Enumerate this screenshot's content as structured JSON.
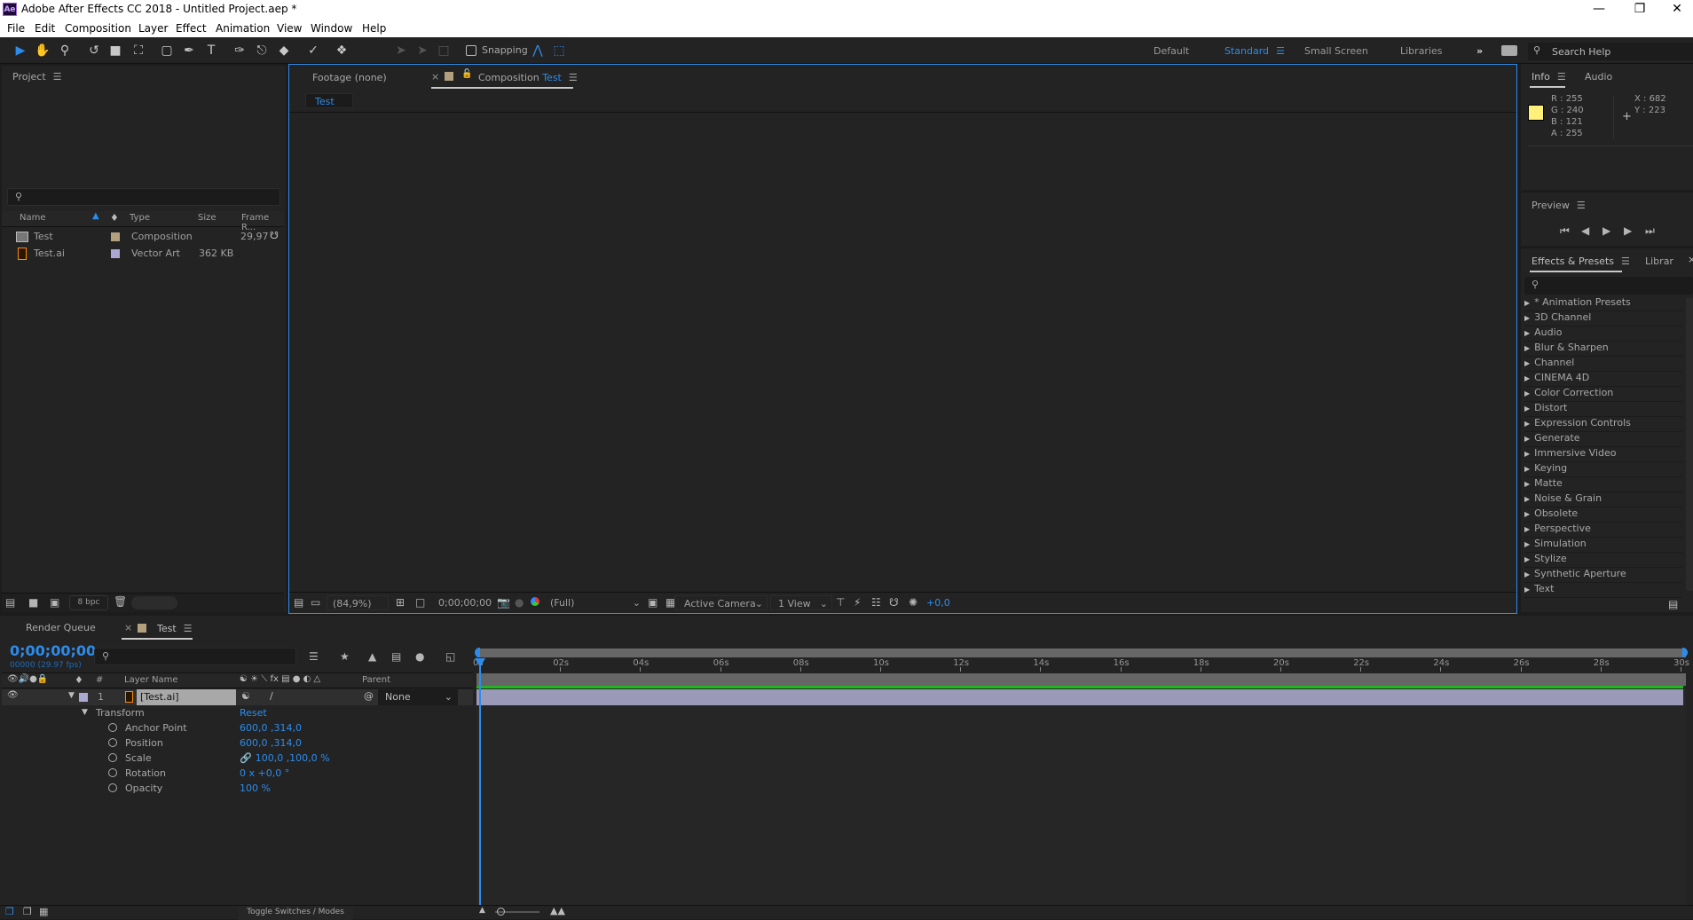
{
  "window": {
    "title": "Adobe After Effects CC 2018 - Untitled Project.aep *",
    "app_badge": "Ae"
  },
  "menu": [
    "File",
    "Edit",
    "Composition",
    "Layer",
    "Effect",
    "Animation",
    "View",
    "Window",
    "Help"
  ],
  "toolbar": {
    "snapping_label": "Snapping",
    "workspaces": [
      "Default",
      "Standard",
      "Small Screen",
      "Libraries"
    ],
    "active_workspace": "Standard",
    "search_help_placeholder": "Search Help"
  },
  "project": {
    "title": "Project",
    "columns": [
      "Name",
      "Type",
      "Size",
      "Frame R..."
    ],
    "items": [
      {
        "name": "Test",
        "type": "Composition",
        "size": "",
        "frame_rate": "29,97",
        "label_color": "#b3a07f"
      },
      {
        "name": "Test.ai",
        "type": "Vector Art",
        "size": "362 KB",
        "frame_rate": "",
        "label_color": "#a9a9d2"
      }
    ],
    "bpc": "8 bpc"
  },
  "viewer": {
    "footage_tab": "Footage (none)",
    "comp_tab_prefix": "Composition",
    "comp_tab_name": "Test",
    "comp_breadcrumb": "Test",
    "zoom": "(84,9%)",
    "timecode": "0;00;00;00",
    "resolution": "(Full)",
    "camera": "Active Camera",
    "views": "1 View",
    "exposure": "+0,0"
  },
  "info": {
    "tab": "Info",
    "tab2": "Audio",
    "r": "255",
    "g": "240",
    "b": "121",
    "a": "255",
    "x": "682",
    "y": "223",
    "swatch": "#fff079"
  },
  "preview": {
    "title": "Preview"
  },
  "effects": {
    "tab": "Effects & Presets",
    "tab2": "Librar",
    "items": [
      "* Animation Presets",
      "3D Channel",
      "Audio",
      "Blur & Sharpen",
      "Channel",
      "CINEMA 4D",
      "Color Correction",
      "Distort",
      "Expression Controls",
      "Generate",
      "Immersive Video",
      "Keying",
      "Matte",
      "Noise & Grain",
      "Obsolete",
      "Perspective",
      "Simulation",
      "Stylize",
      "Synthetic Aperture",
      "Text"
    ]
  },
  "timeline": {
    "tab_render": "Render Queue",
    "tab_comp": "Test",
    "timecode": "0;00;00;00",
    "frame_info": "00000 (29.97 fps)",
    "col_layer_name": "Layer Name",
    "col_parent": "Parent",
    "col_num": "#",
    "layer": {
      "index": "1",
      "name": "[Test.ai]",
      "parent": "None",
      "label_color": "#a9a9d2"
    },
    "transform": {
      "label": "Transform",
      "reset": "Reset",
      "props": [
        {
          "name": "Anchor Point",
          "value": "600,0 ,314,0"
        },
        {
          "name": "Position",
          "value": "600,0 ,314,0"
        },
        {
          "name": "Scale",
          "value": "100,0 ,100,0 %"
        },
        {
          "name": "Rotation",
          "value": "0 x +0,0 °"
        },
        {
          "name": "Opacity",
          "value": "100 %"
        }
      ]
    },
    "ruler": [
      "0s",
      "02s",
      "04s",
      "06s",
      "08s",
      "10s",
      "12s",
      "14s",
      "16s",
      "18s",
      "20s",
      "22s",
      "24s",
      "26s",
      "28s",
      "30s"
    ],
    "toggle_label": "Toggle Switches / Modes"
  }
}
